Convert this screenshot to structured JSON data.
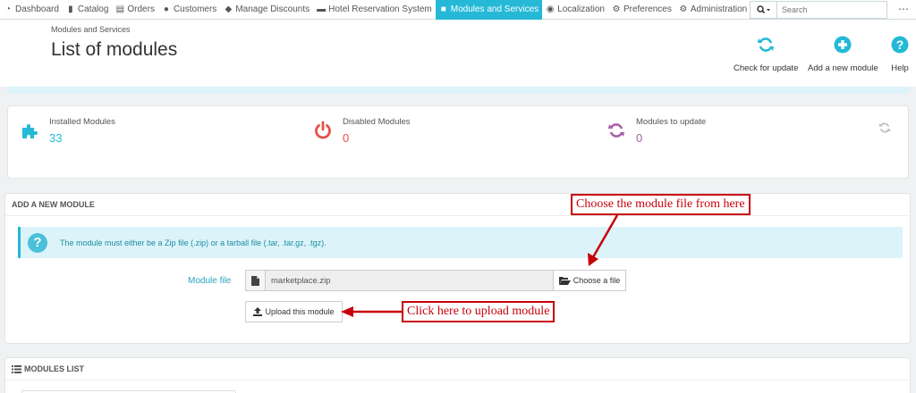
{
  "nav": {
    "items": [
      {
        "label": "Dashboard",
        "icon": "dashboard-icon"
      },
      {
        "label": "Catalog",
        "icon": "book-icon"
      },
      {
        "label": "Orders",
        "icon": "credit-card-icon"
      },
      {
        "label": "Customers",
        "icon": "users-icon"
      },
      {
        "label": "Manage Discounts",
        "icon": "tags-icon"
      },
      {
        "label": "Hotel Reservation System",
        "icon": "bed-icon"
      },
      {
        "label": "Modules and Services",
        "icon": "puzzle-icon",
        "active": true
      },
      {
        "label": "Localization",
        "icon": "globe-icon"
      },
      {
        "label": "Preferences",
        "icon": "wrench-icon"
      },
      {
        "label": "Administration",
        "icon": "cog-icon"
      }
    ],
    "search_placeholder": "Search",
    "active_color": "#25b9d7"
  },
  "header": {
    "breadcrumb": "Modules and Services",
    "title": "List of modules",
    "toolbar": {
      "check_update": "Check for update",
      "add_module": "Add a new module",
      "help": "Help"
    }
  },
  "stats": {
    "installed": {
      "label": "Installed Modules",
      "value": "33",
      "color": "#25b9d7"
    },
    "disabled": {
      "label": "Disabled Modules",
      "value": "0",
      "color": "#e7504a"
    },
    "to_update": {
      "label": "Modules to update",
      "value": "0",
      "color": "#a75fa6"
    }
  },
  "add_module": {
    "heading": "ADD A NEW MODULE",
    "info": "The module must either be a Zip file (.zip) or a tarball file (.tar, .tar.gz, .tgz).",
    "file_label": "Module file",
    "file_value": "marketplace.zip",
    "choose_label": "Choose a file",
    "upload_label": "Upload this module"
  },
  "annotations": {
    "choose": "Choose the module file from here",
    "upload": "Click here to upload module"
  },
  "modules_list": {
    "heading": "MODULES LIST"
  }
}
